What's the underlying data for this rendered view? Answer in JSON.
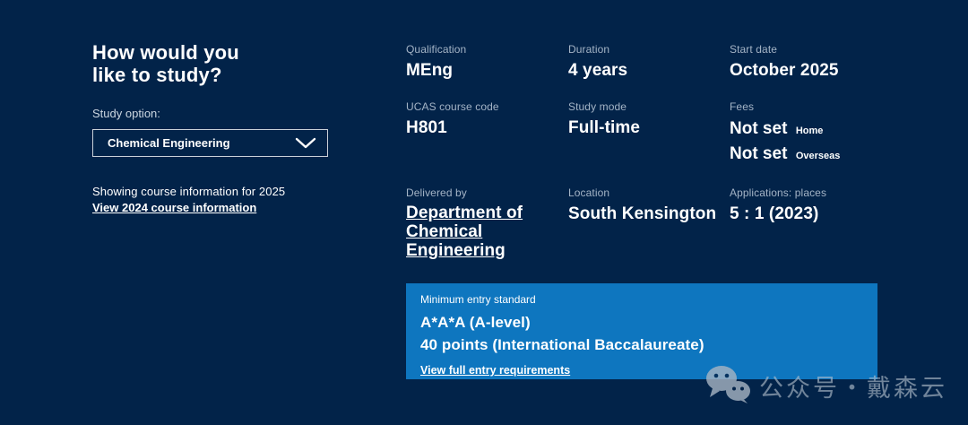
{
  "theme": {
    "background": "#022349",
    "panel_blue": "#0e76bf",
    "label_color": "#a4b4c6"
  },
  "study_panel": {
    "heading_line1": "How would you",
    "heading_line2": "like to study?",
    "study_option_label": "Study option:",
    "dropdown": {
      "selected": "Chemical Engineering",
      "chevron_icon": "chevron-down-icon"
    },
    "showing_text": "Showing course information for 2025",
    "view_2024_link": "View 2024 course information"
  },
  "course_info": {
    "qualification": {
      "label": "Qualification",
      "value": "MEng"
    },
    "duration": {
      "label": "Duration",
      "value": "4 years"
    },
    "start_date": {
      "label": "Start date",
      "value": "October 2025"
    },
    "ucas_code": {
      "label": "UCAS course code",
      "value": "H801"
    },
    "study_mode": {
      "label": "Study mode",
      "value": "Full-time"
    },
    "fees": {
      "label": "Fees",
      "home_value": "Not set",
      "home_tag": "Home",
      "overseas_value": "Not set",
      "overseas_tag": "Overseas"
    },
    "delivered_by": {
      "label": "Delivered by",
      "link_text": "Department of Chemical Engineering"
    },
    "location": {
      "label": "Location",
      "value": "South Kensington"
    },
    "applications": {
      "label": "Applications: places",
      "value": "5 : 1 (2023)"
    }
  },
  "entry_standard": {
    "label": "Minimum entry standard",
    "a_level": "A*A*A (A-level)",
    "ib": "40 points (International Baccalaureate)",
    "link": "View full entry requirements"
  },
  "watermark": {
    "icon": "wechat-icon",
    "text": "公众号・戴森云"
  }
}
